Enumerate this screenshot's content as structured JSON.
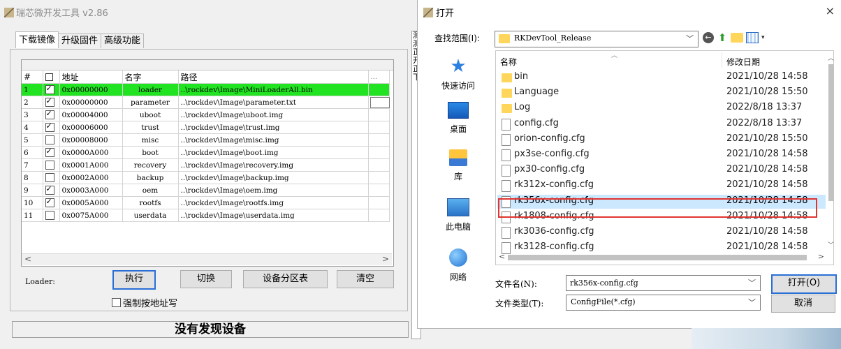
{
  "tool": {
    "title": "瑞芯微开发工具 v2.86",
    "tabs": [
      "下载镜像",
      "升级固件",
      "高级功能"
    ],
    "grid": {
      "headers": {
        "num": "#",
        "addr": "地址",
        "name": "名字",
        "path": "路径",
        "more": "..."
      },
      "rows": [
        {
          "num": "1",
          "checked": true,
          "addr": "0x00000000",
          "name": "loader",
          "path": "..\\rockdev\\Image\\MiniLoaderAll.bin"
        },
        {
          "num": "2",
          "checked": true,
          "addr": "0x00000000",
          "name": "parameter",
          "path": "..\\rockdev\\Image\\parameter.txt"
        },
        {
          "num": "3",
          "checked": true,
          "addr": "0x00004000",
          "name": "uboot",
          "path": "..\\rockdev\\Image\\uboot.img"
        },
        {
          "num": "4",
          "checked": true,
          "addr": "0x00006000",
          "name": "trust",
          "path": "..\\rockdev\\Image\\trust.img"
        },
        {
          "num": "5",
          "checked": false,
          "addr": "0x00008000",
          "name": "misc",
          "path": "..\\rockdev\\Image\\misc.img"
        },
        {
          "num": "6",
          "checked": true,
          "addr": "0x0000A000",
          "name": "boot",
          "path": "..\\rockdev\\Image\\boot.img"
        },
        {
          "num": "7",
          "checked": false,
          "addr": "0x0001A000",
          "name": "recovery",
          "path": "..\\rockdev\\Image\\recovery.img"
        },
        {
          "num": "8",
          "checked": false,
          "addr": "0x0002A000",
          "name": "backup",
          "path": "..\\rockdev\\Image\\backup.img"
        },
        {
          "num": "9",
          "checked": true,
          "addr": "0x0003A000",
          "name": "oem",
          "path": "..\\rockdev\\Image\\oem.img"
        },
        {
          "num": "10",
          "checked": true,
          "addr": "0x0005A000",
          "name": "rootfs",
          "path": "..\\rockdev\\Image\\rootfs.img"
        },
        {
          "num": "11",
          "checked": false,
          "addr": "0x0075A000",
          "name": "userdata",
          "path": "..\\rockdev\\Image\\userdata.img"
        }
      ]
    },
    "loader_label": "Loader:",
    "buttons": {
      "exec": "执行",
      "switch": "切换",
      "partition": "设备分区表",
      "clear": "清空"
    },
    "force_addr_label": "强制按地址写",
    "status": "没有发现设备",
    "log_lines": [
      "测",
      "测",
      "正",
      "开",
      "正",
      "下"
    ],
    "colors": {
      "selected_row": "#21e321",
      "highlight_box": "#e0342f"
    }
  },
  "dialog": {
    "title": "打开",
    "close": "×",
    "look_in_label": "查找范围(I):",
    "look_in_value": "RKDevTool_Release",
    "places": [
      "快速访问",
      "桌面",
      "库",
      "此电脑",
      "网络"
    ],
    "columns": {
      "name": "名称",
      "date": "修改日期"
    },
    "files": [
      {
        "type": "folder",
        "name": "bin",
        "date": "2021/10/28 14:58"
      },
      {
        "type": "folder",
        "name": "Language",
        "date": "2021/10/28 15:50"
      },
      {
        "type": "folder",
        "name": "Log",
        "date": "2022/8/18 13:37"
      },
      {
        "type": "file",
        "name": "config.cfg",
        "date": "2022/8/18 13:37"
      },
      {
        "type": "file",
        "name": "orion-config.cfg",
        "date": "2021/10/28 15:50"
      },
      {
        "type": "file",
        "name": "px3se-config.cfg",
        "date": "2021/10/28 14:58"
      },
      {
        "type": "file",
        "name": "px30-config.cfg",
        "date": "2021/10/28 14:58"
      },
      {
        "type": "file",
        "name": "rk312x-config.cfg",
        "date": "2021/10/28 14:58"
      },
      {
        "type": "file",
        "name": "rk356x-config.cfg",
        "date": "2021/10/28 14:58",
        "selected": true
      },
      {
        "type": "file",
        "name": "rk1808-config.cfg",
        "date": "2021/10/28 14:58"
      },
      {
        "type": "file",
        "name": "rk3036-config.cfg",
        "date": "2021/10/28 14:58"
      },
      {
        "type": "file",
        "name": "rk3128-config.cfg",
        "date": "2021/10/28 14:58"
      }
    ],
    "filename_label": "文件名(N):",
    "filename_value": "rk356x-config.cfg",
    "filetype_label": "文件类型(T):",
    "filetype_value": "ConfigFile(*.cfg)",
    "open_button": "打开(O)",
    "cancel_button": "取消",
    "icons": {
      "back": "back-arrow-icon",
      "up": "up-folder-icon",
      "new": "new-folder-icon",
      "view": "view-menu-icon"
    }
  }
}
